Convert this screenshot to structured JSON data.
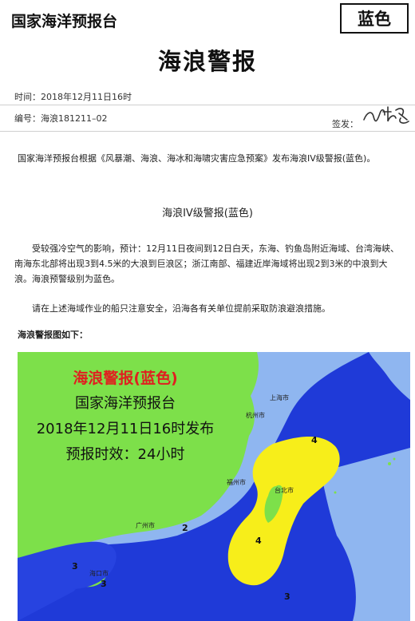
{
  "header": {
    "agency": "国家海洋预报台",
    "level_badge": "蓝色",
    "title": "海浪警报",
    "time": "时间：2018年12月11日16时",
    "number": "编号：海浪181211–02",
    "sign_label": "签发："
  },
  "intro": "国家海洋预报台根据《风暴潮、海浪、海冰和海啸灾害应急预案》发布海浪IV级警报(蓝色)。",
  "subtitle": "海浪IV级警报(蓝色)",
  "paragraphs": [
    "受较强冷空气的影响，预计：12月11日夜间到12日白天，东海、钓鱼岛附近海域、台湾海峡、南海东北部将出现3到4.5米的大浪到巨浪区；浙江南部、福建近岸海域将出现2到3米的中浪到大浪。海浪预警级别为蓝色。",
    "请在上述海域作业的船只注意安全，沿海各有关单位提前采取防浪避浪措施。"
  ],
  "map_heading": "海浪警报图如下：",
  "map": {
    "title": "海浪警报(蓝色)",
    "line1": "国家海洋预报台",
    "line2": "2018年12月11日16时发布",
    "line3": "预报时效：24小时",
    "cities": {
      "shanghai": "上海市",
      "hangzhou": "杭州市",
      "fuzhou": "福州市",
      "taibei": "台北市",
      "guangzhou": "广州市",
      "haikou": "海口市"
    },
    "contours": {
      "c4a": "4",
      "c4b": "4",
      "c3a": "3",
      "c3b": "3",
      "c3c": "3",
      "c2": "2"
    },
    "colors": {
      "land": "#7de04a",
      "shallow_sea": "#8fb6f0",
      "warn_3m": "#1f3ad8",
      "warn_4m": "#f7ee1a"
    }
  }
}
